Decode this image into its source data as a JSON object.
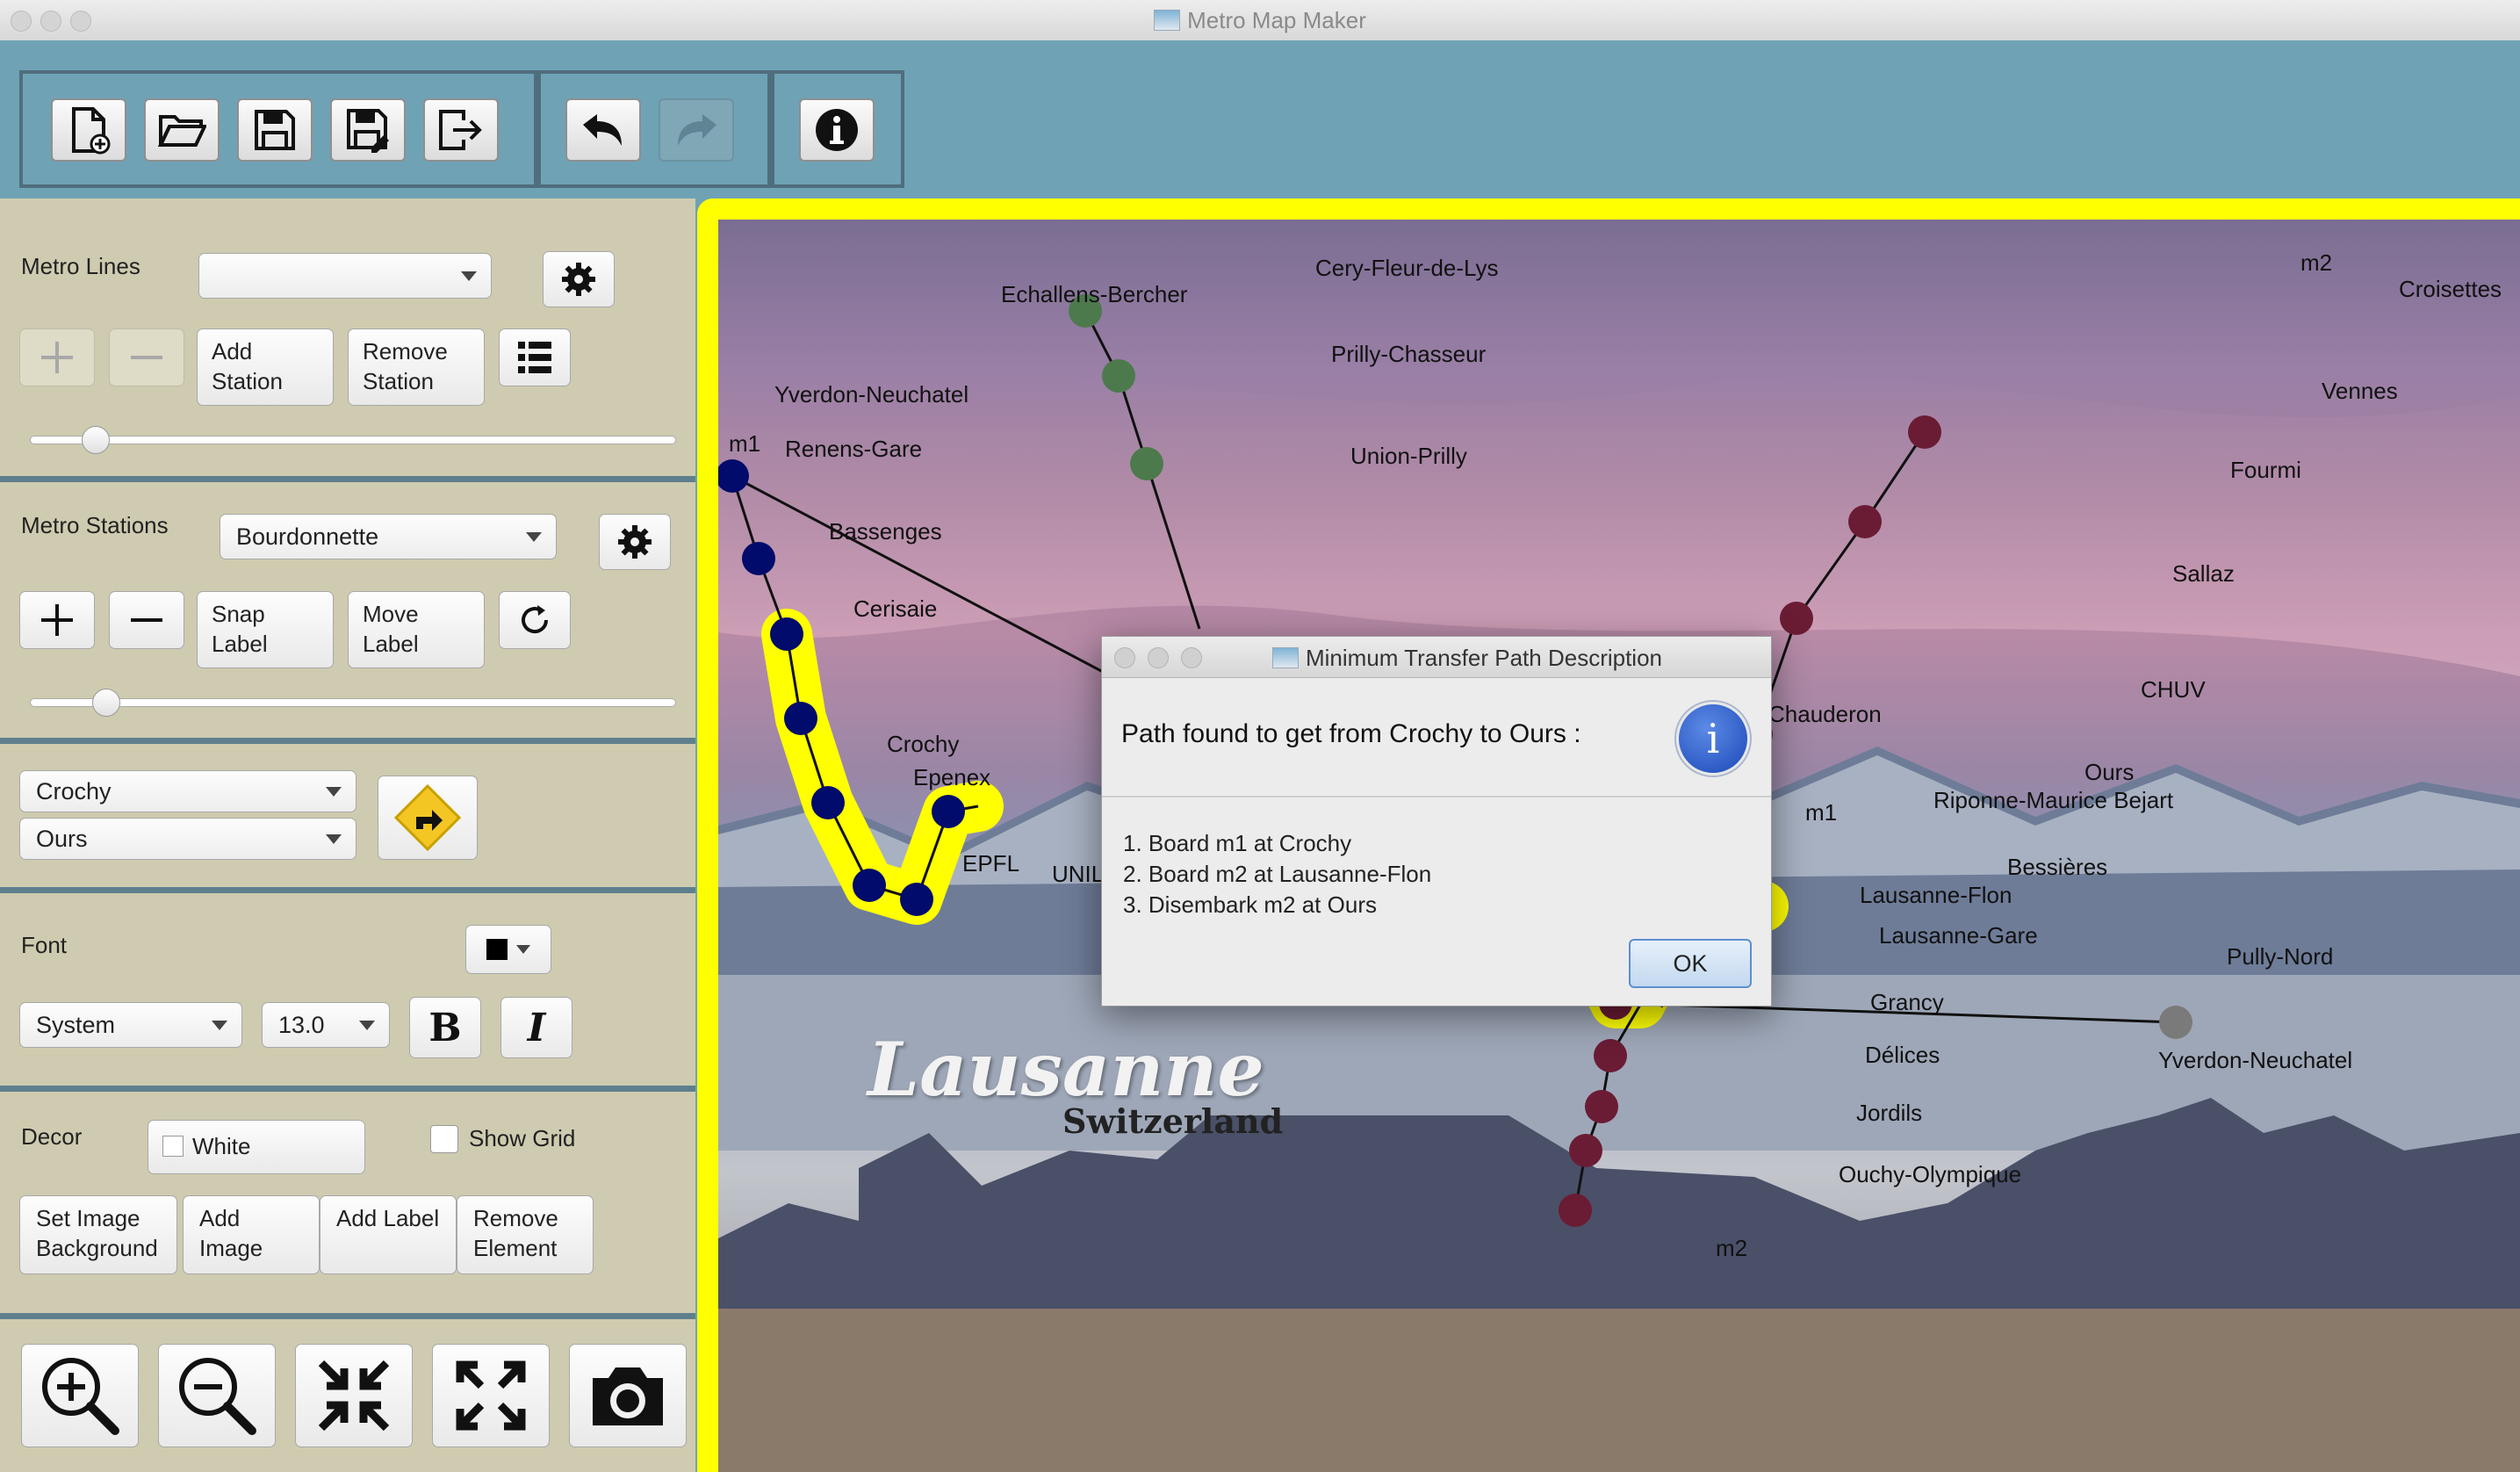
{
  "app": {
    "title": "Metro Map Maker",
    "accent_color": "#6fa2b5",
    "highlight_color": "#ffff00"
  },
  "toolbar": {
    "buttons": [
      "new-icon",
      "open-icon",
      "save-icon",
      "save-as-icon",
      "export-icon",
      "undo-icon",
      "redo-icon",
      "info-icon"
    ]
  },
  "lines_panel": {
    "label": "Metro Lines",
    "selected_line": "",
    "add_station_label": "Add Station",
    "remove_station_label": "Remove Station",
    "line_thickness": 0.1
  },
  "stations_panel": {
    "label": "Metro Stations",
    "selected_station": "Bourdonnette",
    "snap_label": "Snap Label",
    "move_label": "Move Label",
    "station_radius": 0.12
  },
  "route_panel": {
    "from": "Crochy",
    "to": "Ours"
  },
  "font_panel": {
    "label": "Font",
    "family": "System",
    "size": "13.0",
    "bold": "B",
    "italic": "I"
  },
  "decor_panel": {
    "label": "Decor",
    "white_label": "White",
    "show_grid_label": "Show Grid",
    "set_image_bg_label": "Set Image Background",
    "add_image_label": "Add Image",
    "add_label_label": "Add Label",
    "remove_element_label": "Remove Element"
  },
  "map": {
    "city": "Lausanne",
    "country": "Switzerland",
    "line_m1_color": "#000b6b",
    "line_m2_color": "#6a1c34",
    "green_line_color": "#4c7a4c",
    "labels": {
      "echallens": "Echallens-Bercher",
      "cery": "Cery-Fleur-de-Lys",
      "prilly": "Prilly-Chasseur",
      "union": "Union-Prilly",
      "yverdon1": "Yverdon-Neuchatel",
      "m1_top": "m1",
      "renens": "Renens-Gare",
      "bassenges": "Bassenges",
      "cerisaie": "Cerisaie",
      "crochy": "Crochy",
      "epenex": "Epenex",
      "epfl": "EPFL",
      "unil": "UNIL",
      "m2_top": "m2",
      "croisettes": "Croisettes",
      "vennes": "Vennes",
      "fourmi": "Fourmi",
      "sallaz": "Sallaz",
      "chuv": "CHUV",
      "ours": "Ours",
      "riponne": "Riponne-Maurice Bejart",
      "chauderon": "Chauderon",
      "m1_end": "m1",
      "bessieres": "Bessières",
      "flon": "Lausanne-Flon",
      "gare": "Lausanne-Gare",
      "pully": "Pully-Nord",
      "grancy": "Grancy",
      "delices": "Délices",
      "jordils": "Jordils",
      "ouchy": "Ouchy-Olympique",
      "yverdon2": "Yverdon-Neuchatel",
      "m2_end": "m2"
    }
  },
  "dialog": {
    "title": "Minimum Transfer Path Description",
    "heading": "Path found to get from Crochy to Ours :",
    "steps": {
      "s1": "1. Board m1 at Crochy",
      "s2": "2. Board m2 at Lausanne-Flon",
      "s3": "3. Disembark m2 at Ours"
    },
    "ok_label": "OK"
  }
}
